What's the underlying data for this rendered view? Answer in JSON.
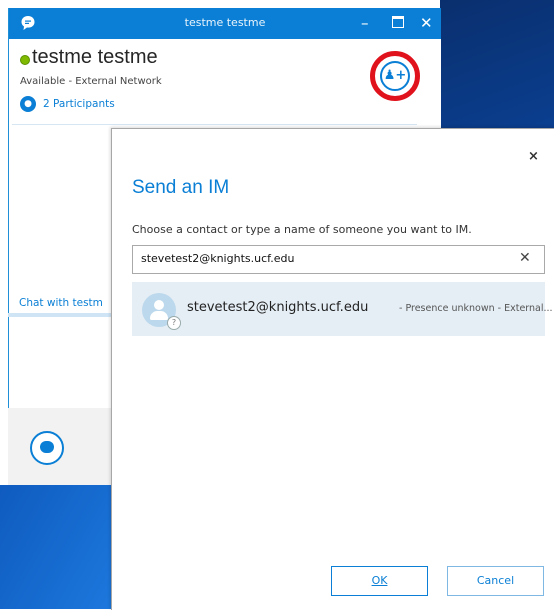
{
  "window": {
    "title": "testme testme"
  },
  "contact": {
    "name": "testme testme",
    "status": "Available - External Network",
    "participants": "2 Participants"
  },
  "conversation": {
    "chat_with": "Chat with testm"
  },
  "dialog": {
    "close_glyph": "×",
    "title": "Send an IM",
    "prompt": "Choose a contact or type a name of someone you want to IM.",
    "search_value": "stevetest2@knights.ucf.edu",
    "clear_glyph": "✕",
    "result": {
      "email": "stevetest2@knights.ucf.edu",
      "presence": "- Presence unknown - External...",
      "badge": "?"
    },
    "ok_label": "OK",
    "cancel_label": "Cancel"
  },
  "colors": {
    "accent": "#0a7fd5",
    "highlight_ring": "#e0121b"
  },
  "icons": {
    "app": "skype-chat-icon",
    "add_people": "add-person-icon",
    "participants": "participants-icon",
    "chat": "chat-bubble-icon"
  }
}
